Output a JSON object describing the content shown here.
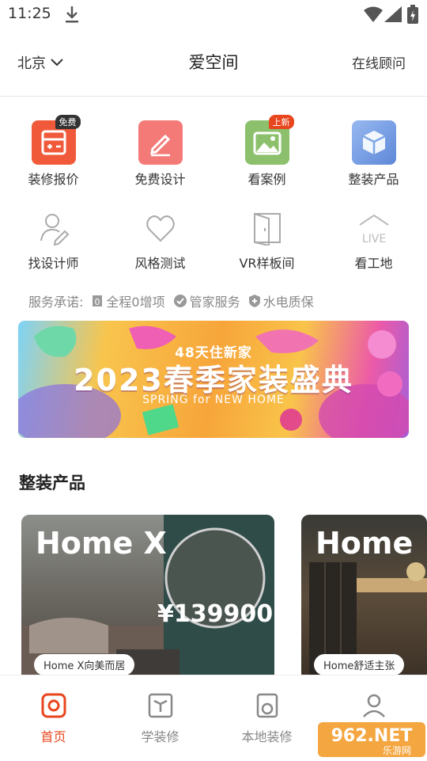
{
  "status_bar": {
    "time": "11:25"
  },
  "header": {
    "city": "北京",
    "title": "爱空间",
    "consult": "在线顾问"
  },
  "grid": [
    {
      "label": "装修报价",
      "icon": "quote-calculator-icon",
      "badge": "免费",
      "color": "#f05a3a"
    },
    {
      "label": "免费设计",
      "icon": "design-pen-icon",
      "badge": "",
      "color": "#f47a78"
    },
    {
      "label": "看案例",
      "icon": "case-photo-icon",
      "badge": "上新",
      "color": "#8cc06d"
    },
    {
      "label": "整装产品",
      "icon": "product-box-icon",
      "badge": "",
      "color": "#7da6e8"
    },
    {
      "label": "找设计师",
      "icon": "designer-icon"
    },
    {
      "label": "风格测试",
      "icon": "heart-icon"
    },
    {
      "label": "VR样板间",
      "icon": "vr-door-icon"
    },
    {
      "label": "看工地",
      "icon": "live-site-icon"
    }
  ],
  "promise": {
    "label": "服务承诺:",
    "items": [
      "全程0增项",
      "管家服务",
      "水电质保"
    ]
  },
  "banner": {
    "subtitle": "48天住新家",
    "title": "2023春季家装盛典",
    "english": "SPRING for NEW HOME"
  },
  "section": {
    "title": "整装产品"
  },
  "products": [
    {
      "title": "Home X",
      "price": "¥139900",
      "tag": "Home X向美而居"
    },
    {
      "title": "Home",
      "price": "",
      "tag": "Home舒适主张"
    }
  ],
  "bottom_nav": [
    {
      "label": "首页",
      "icon": "home-icon",
      "active": true
    },
    {
      "label": "学装修",
      "icon": "book-icon",
      "active": false
    },
    {
      "label": "本地装修",
      "icon": "local-decoration-icon",
      "active": false
    },
    {
      "label": "",
      "icon": "profile-icon",
      "active": false
    }
  ],
  "watermark": {
    "text": "962.NET",
    "subtext": "乐游网"
  },
  "colors": {
    "accent": "#e8461e"
  }
}
